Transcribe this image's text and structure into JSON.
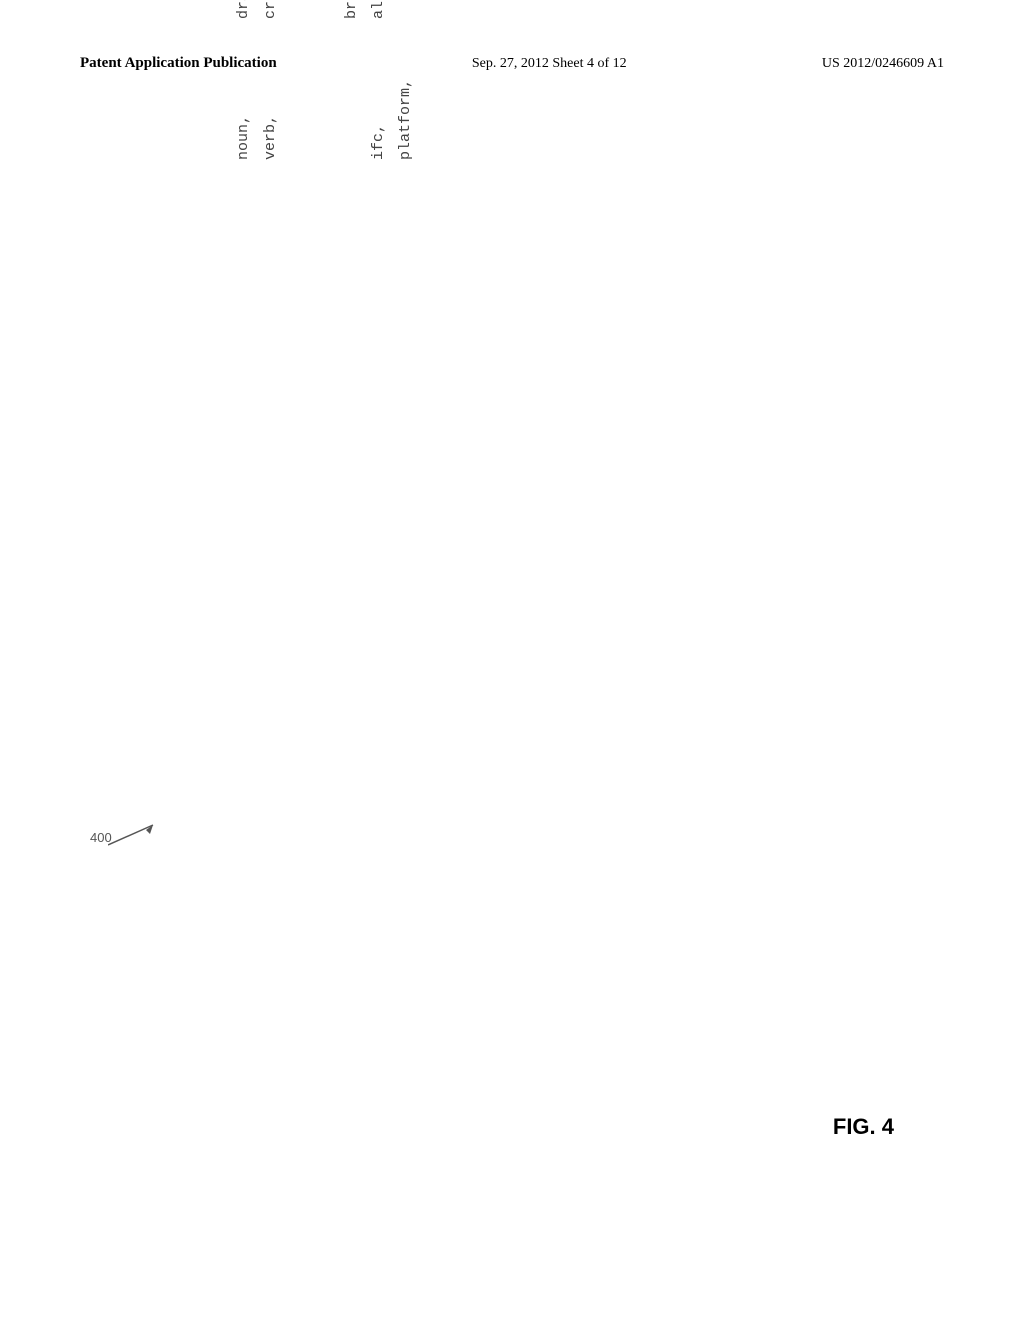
{
  "header": {
    "left": "Patent Application Publication",
    "center": "Sep. 27, 2012   Sheet 4 of 12",
    "right": "US 2012/0246609 A1"
  },
  "figure": {
    "label": "FIG. 4",
    "ref_number": "400",
    "content": {
      "left_column": "noun,\nverb,\n\n\nifc,\nplatform,",
      "right_column": "draft email\ncreate, list, view, move, send_,\n    archive, delete, print,\n        attach, unattach\nbrowser\nall_email_env"
    }
  }
}
